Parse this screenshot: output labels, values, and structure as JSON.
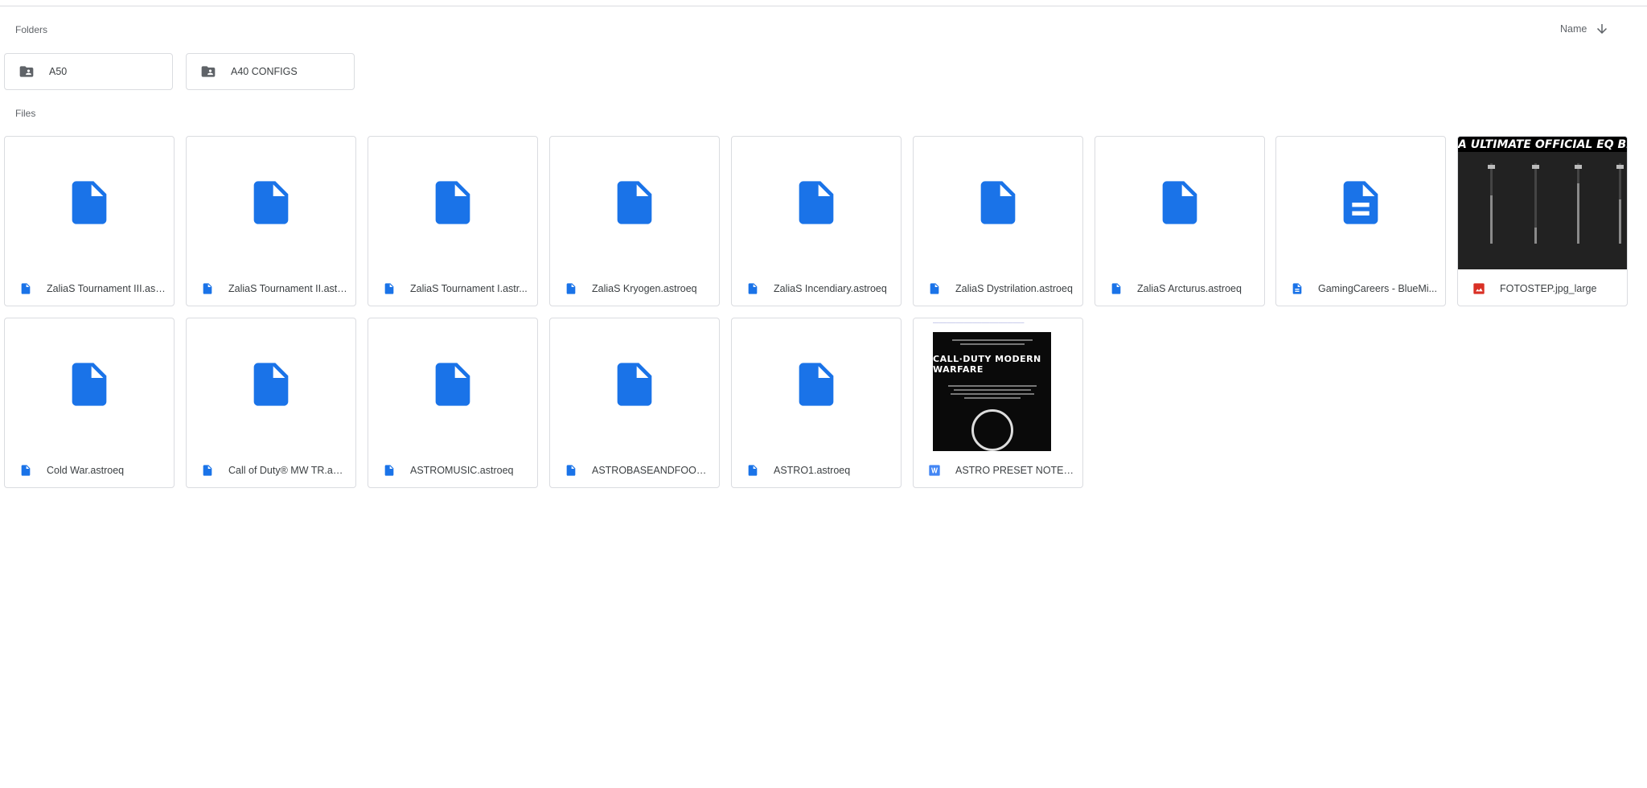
{
  "sections": {
    "folders_label": "Folders",
    "files_label": "Files"
  },
  "sort": {
    "label": "Name",
    "icon": "arrow-down-icon"
  },
  "folders": [
    {
      "name": "A50",
      "icon": "shared-folder-icon"
    },
    {
      "name": "A40 CONFIGS",
      "icon": "shared-folder-icon"
    }
  ],
  "files": [
    {
      "name": "ZaliaS Tournament III.ast...",
      "type": "file"
    },
    {
      "name": "ZaliaS Tournament II.astr...",
      "type": "file"
    },
    {
      "name": "ZaliaS Tournament I.astr...",
      "type": "file"
    },
    {
      "name": "ZaliaS Kryogen.astroeq",
      "type": "file"
    },
    {
      "name": "ZaliaS Incendiary.astroeq",
      "type": "file"
    },
    {
      "name": "ZaliaS Dystrilation.astroeq",
      "type": "file"
    },
    {
      "name": "ZaliaS Arcturus.astroeq",
      "type": "file"
    },
    {
      "name": "GamingCareers - BlueMi...",
      "type": "doc"
    },
    {
      "name": "FOTOSTEP.jpg_large",
      "type": "image",
      "thumb_text": "A ULTIMATE OFFICIAL EQ BREAKER/FPS/FOOTSTEPS"
    },
    {
      "name": "Cold War.astroeq",
      "type": "file"
    },
    {
      "name": "Call of Duty® MW TR.ast...",
      "type": "file"
    },
    {
      "name": "ASTROMUSIC.astroeq",
      "type": "file"
    },
    {
      "name": "ASTROBASEANDFOOTS...",
      "type": "file"
    },
    {
      "name": "ASTRO1.astroeq",
      "type": "file"
    },
    {
      "name": "ASTRO PRESET NOTES.d...",
      "type": "word",
      "thumb_text": "CALL·DUTY MODERN WARFARE"
    }
  ],
  "colors": {
    "accent": "#1a73e8",
    "image_red": "#d93025",
    "word_blue": "#4285f4",
    "folder_gray": "#5f6368"
  }
}
